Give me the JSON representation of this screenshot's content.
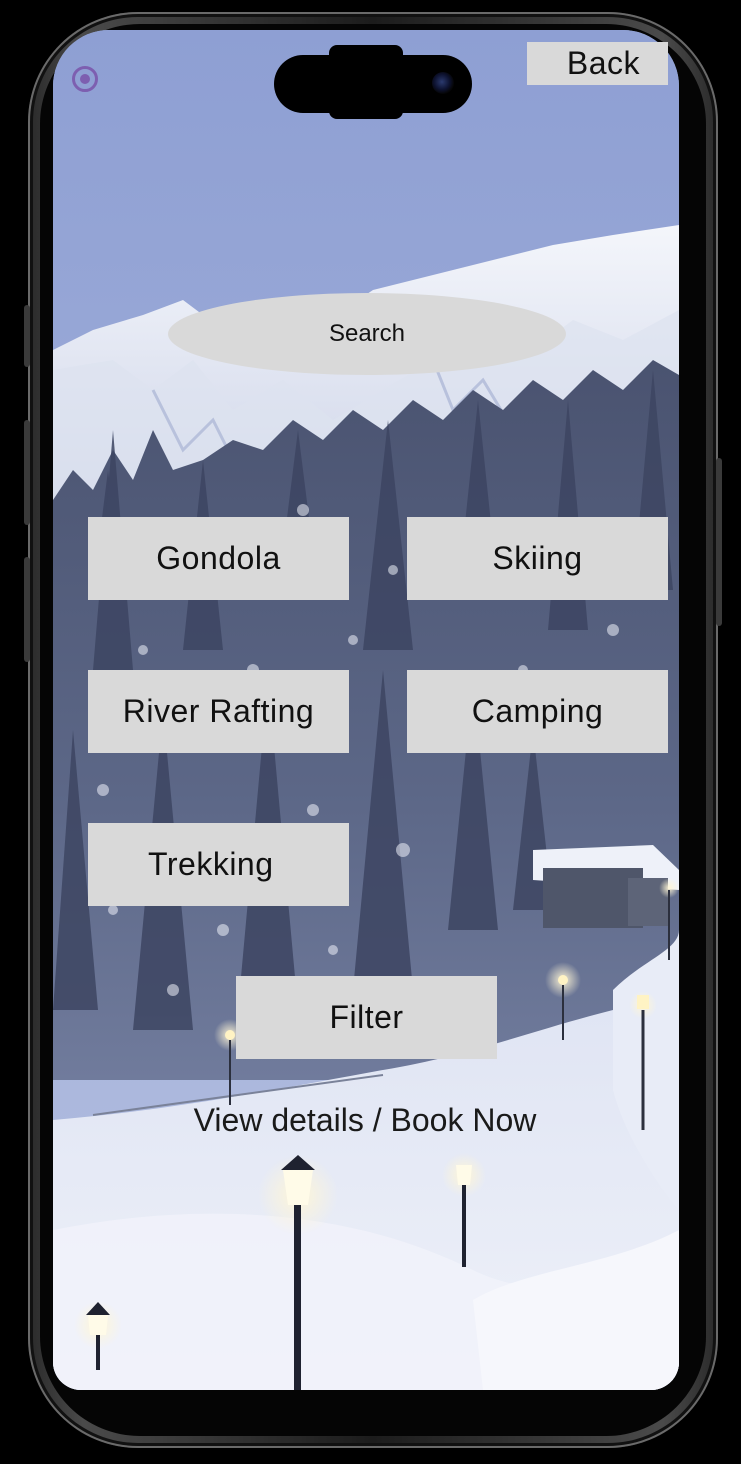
{
  "header": {
    "back_label": "Back",
    "status_icon": "radio-icon"
  },
  "search": {
    "placeholder": "Search"
  },
  "activities": [
    {
      "label": "Gondola"
    },
    {
      "label": "Skiing"
    },
    {
      "label": "River Rafting"
    },
    {
      "label": "Camping"
    },
    {
      "label": "Trekking"
    }
  ],
  "actions": {
    "filter_label": "Filter",
    "details_link": "View details / Book Now"
  },
  "colors": {
    "button_bg": "#d9d9d9",
    "accent": "#7d5fb0",
    "sky": "#9fb0da"
  }
}
